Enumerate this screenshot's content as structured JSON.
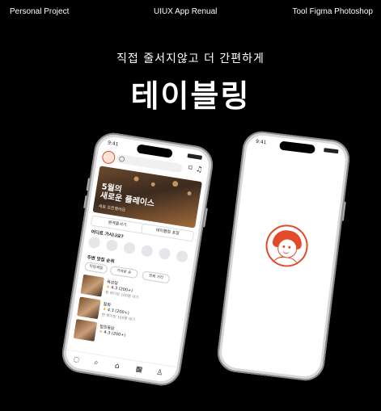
{
  "header": {
    "left": "Personal Project",
    "center": "UIUX App Renual",
    "right": "Tool Figma Photoshop"
  },
  "hero": {
    "subtitle": "직접 줄서지않고 더 간편하게",
    "title": "테이블링"
  },
  "phone_left": {
    "status_time": "9:41",
    "banner": {
      "headline_line1": "5월의",
      "headline_line2": "새로운 플레이스",
      "sub": "새로 오픈했어요"
    },
    "quick_actions": [
      "원격줄서기",
      "테이블링 포장"
    ],
    "section_where": "어디로 가시나요?",
    "section_nearby": "주변 맛집 순위",
    "chips": [
      "타임세일",
      "가까운 순",
      "전체 거리"
    ],
    "items": [
      {
        "name": "육성당",
        "rating": "4.3",
        "reviews": "(200+)",
        "meta": "현 웨이팅 100명 대기"
      },
      {
        "name": "찰화",
        "rating": "4.3",
        "reviews": "(200+)",
        "meta": "현 웨이팅 100명 대기"
      },
      {
        "name": "법트통닭",
        "rating": "4.3",
        "reviews": "(200+)",
        "meta": ""
      }
    ],
    "tabs": [
      "chat-icon",
      "search-icon",
      "home-icon",
      "calendar-icon",
      "profile-icon"
    ]
  },
  "phone_right": {
    "status_time": "9:41"
  },
  "colors": {
    "background": "#000000",
    "accent": "#e24a2a",
    "star": "#f5a623"
  }
}
